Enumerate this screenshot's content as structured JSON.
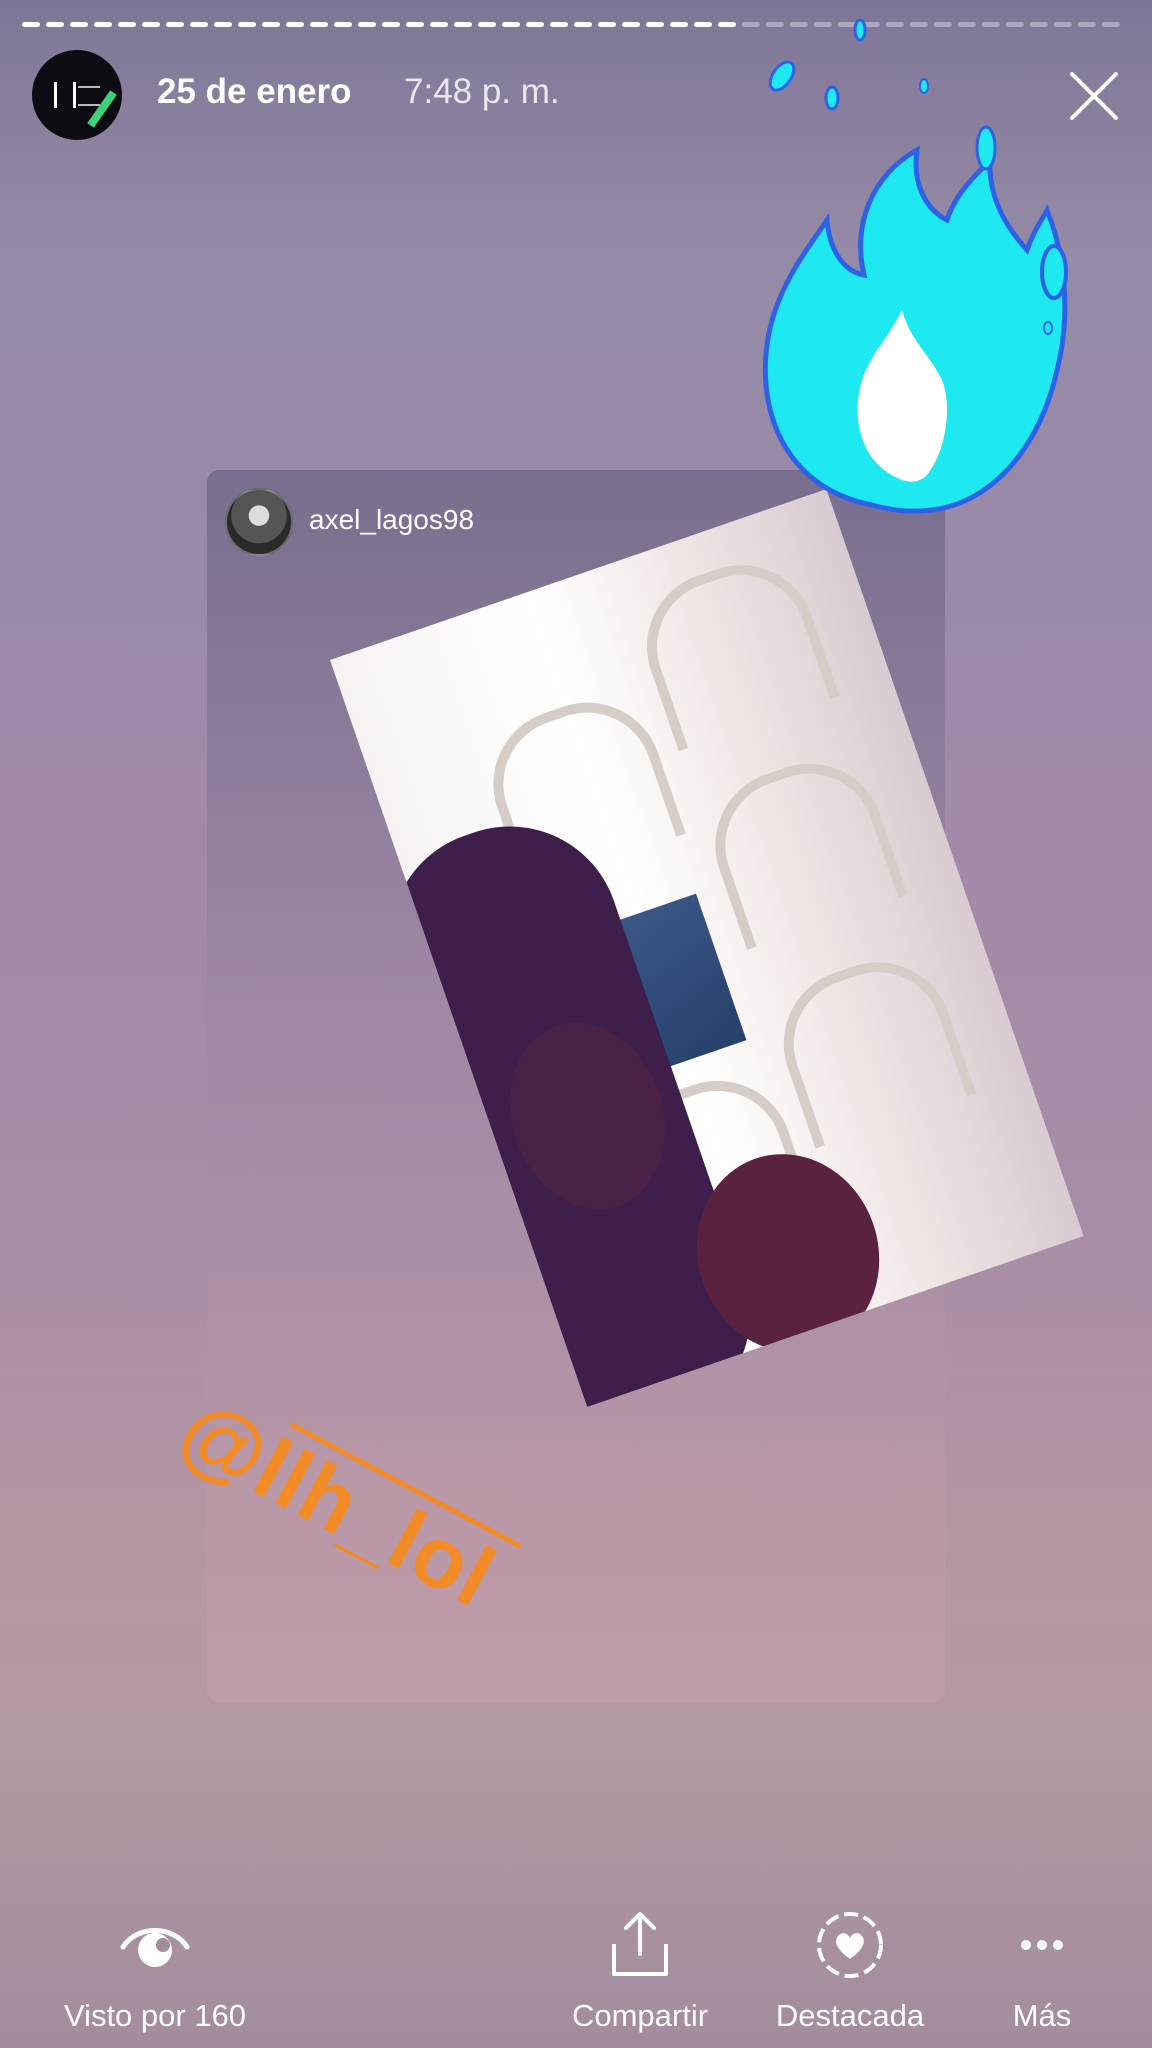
{
  "story": {
    "progress": 0.65,
    "colors": {
      "progress_done": "#ffffff",
      "progress_todo": "rgba(255,255,255,0.35)",
      "flame": "#1ee8f0",
      "mention": "#f28a25"
    },
    "header": {
      "date": "25 de enero",
      "time": "7:48 p. m.",
      "close_icon": "close-icon"
    },
    "shared_post": {
      "username": "axel_lagos98"
    },
    "sticker": {
      "mention": "@llh_lol",
      "flame_icon": "fire-sticker-icon"
    }
  },
  "footer": {
    "seen": {
      "label": "Visto por 160",
      "icon": "eye-icon"
    },
    "share": {
      "label": "Compartir",
      "icon": "share-icon"
    },
    "highlight": {
      "label": "Destacada",
      "icon": "highlight-heart-icon"
    },
    "more": {
      "label": "Más",
      "icon": "more-icon"
    }
  }
}
